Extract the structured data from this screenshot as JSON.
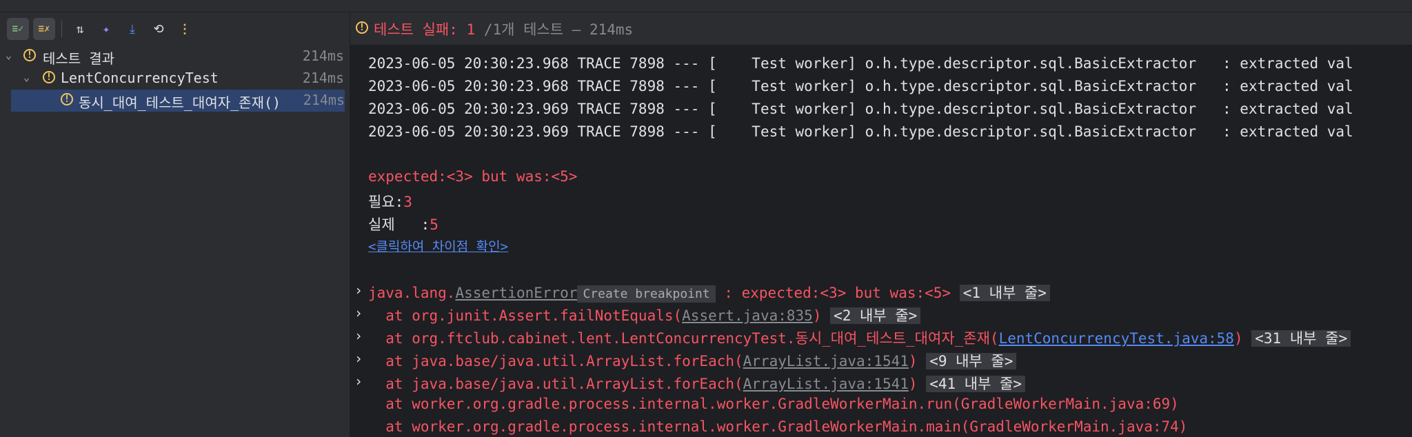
{
  "toolbar": {
    "buttons": [
      {
        "name": "show-passed-icon",
        "glyph": "≡✓"
      },
      {
        "name": "show-ignored-icon",
        "glyph": "≡✗"
      },
      {
        "name": "sort-icon",
        "glyph": "⇅"
      },
      {
        "name": "import-tests-icon",
        "glyph": "✦"
      },
      {
        "name": "export-tests-icon",
        "glyph": "⤓"
      },
      {
        "name": "history-icon",
        "glyph": "⟲"
      },
      {
        "name": "more-options-icon",
        "glyph": "⋮"
      }
    ]
  },
  "tree": [
    {
      "label": "테스트 결과",
      "time": "214ms"
    },
    {
      "label": "LentConcurrencyTest",
      "time": "214ms"
    },
    {
      "label": "동시_대여_테스트_대여자_존재()",
      "time": "214ms"
    }
  ],
  "status": {
    "prefix": "테스트 실패: ",
    "count": "1",
    "suffix": " /1개 테스트 – 214ms"
  },
  "logs": [
    "2023-06-05 20:30:23.968 TRACE 7898 --- [    Test worker] o.h.type.descriptor.sql.BasicExtractor   : extracted val",
    "2023-06-05 20:30:23.968 TRACE 7898 --- [    Test worker] o.h.type.descriptor.sql.BasicExtractor   : extracted val",
    "2023-06-05 20:30:23.969 TRACE 7898 --- [    Test worker] o.h.type.descriptor.sql.BasicExtractor   : extracted val",
    "2023-06-05 20:30:23.969 TRACE 7898 --- [    Test worker] o.h.type.descriptor.sql.BasicExtractor   : extracted val"
  ],
  "result": {
    "message": "expected:<3> but was:<5>",
    "expected_label": "필요:",
    "expected_value": "3",
    "actual_label": "실제   :",
    "actual_value": "5",
    "diff_link": "<클릭하여 차이점 확인>"
  },
  "stack": {
    "exception_prefix": "java.lang.",
    "exception_class": "AssertionError",
    "breakpoint_tip": "Create breakpoint",
    "exception_msg": " : expected:<3> but was:<5>",
    "exception_chip": "<1 내부 줄>",
    "frames": [
      {
        "pre": "  at org.junit.Assert.failNotEquals(",
        "link": "Assert.java:835",
        "post": ")",
        "chip": "<2 내부 줄>",
        "link_style": "ul"
      },
      {
        "pre": "  at org.ftclub.cabinet.lent.LentConcurrencyTest.동시_대여_테스트_대여자_존재(",
        "link": "LentConcurrencyTest.java:58",
        "post": ")",
        "chip": "<31 내부 줄>",
        "link_style": "link"
      },
      {
        "pre": "  at java.base/java.util.ArrayList.forEach(",
        "link": "ArrayList.java:1541",
        "post": ")",
        "chip": "<9 내부 줄>",
        "link_style": "ul"
      },
      {
        "pre": "  at java.base/java.util.ArrayList.forEach(",
        "link": "ArrayList.java:1541",
        "post": ")",
        "chip": "<41 내부 줄>",
        "link_style": "ul"
      },
      {
        "pre": "  at worker.org.gradle.process.internal.worker.GradleWorkerMain.run(GradleWorkerMain.java:69)",
        "link": "",
        "post": "",
        "chip": "",
        "link_style": "ul"
      },
      {
        "pre": "  at worker.org.gradle.process.internal.worker.GradleWorkerMain.main(GradleWorkerMain.java:74)",
        "link": "",
        "post": "",
        "chip": "",
        "link_style": "ul"
      }
    ]
  }
}
